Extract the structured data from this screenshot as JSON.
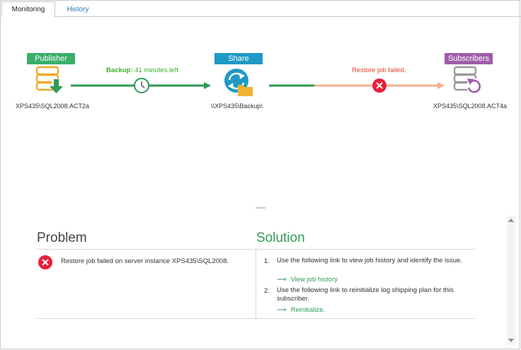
{
  "tabs": [
    {
      "label": "Monitoring",
      "active": true
    },
    {
      "label": "History",
      "active": false
    }
  ],
  "flow": {
    "publisher": {
      "label": "Publisher",
      "caption": "XPS435\\SQL2008.ACT2a",
      "color": "#3aae6b"
    },
    "share": {
      "label": "Share",
      "caption": "\\\\XPS435\\Backup\\",
      "color": "#1f9ac6"
    },
    "subscribers": {
      "label": "Subscribers",
      "caption": "XPS435\\SQL2008.ACT4a",
      "color": "#a05ea8"
    },
    "backup_status": {
      "prefix": "Backup:",
      "text": "41 minutes left",
      "color": "#3aae27"
    },
    "restore_status": {
      "text": "Restore job failed.",
      "color": "#e4442a"
    },
    "icons": [
      "database-export-icon",
      "clock-icon",
      "network-share-icon",
      "folder-icon",
      "error-icon",
      "database-refresh-icon"
    ]
  },
  "problem": {
    "heading": "Problem",
    "text": "Restore job failed on server instance XPS435\\SQL2008."
  },
  "solution": {
    "heading": "Solution",
    "steps": [
      {
        "num": "1.",
        "text": "Use the following link to view job history and identify the issue.",
        "link": "View job history"
      },
      {
        "num": "2.",
        "text": "Use the following link to reinitialize log shipping plan for this subscriber.",
        "link": "Reinitialize."
      }
    ]
  },
  "colors": {
    "green": "#2e9b57",
    "error_red": "#e5203a",
    "failed_line": "#f2b08f"
  }
}
